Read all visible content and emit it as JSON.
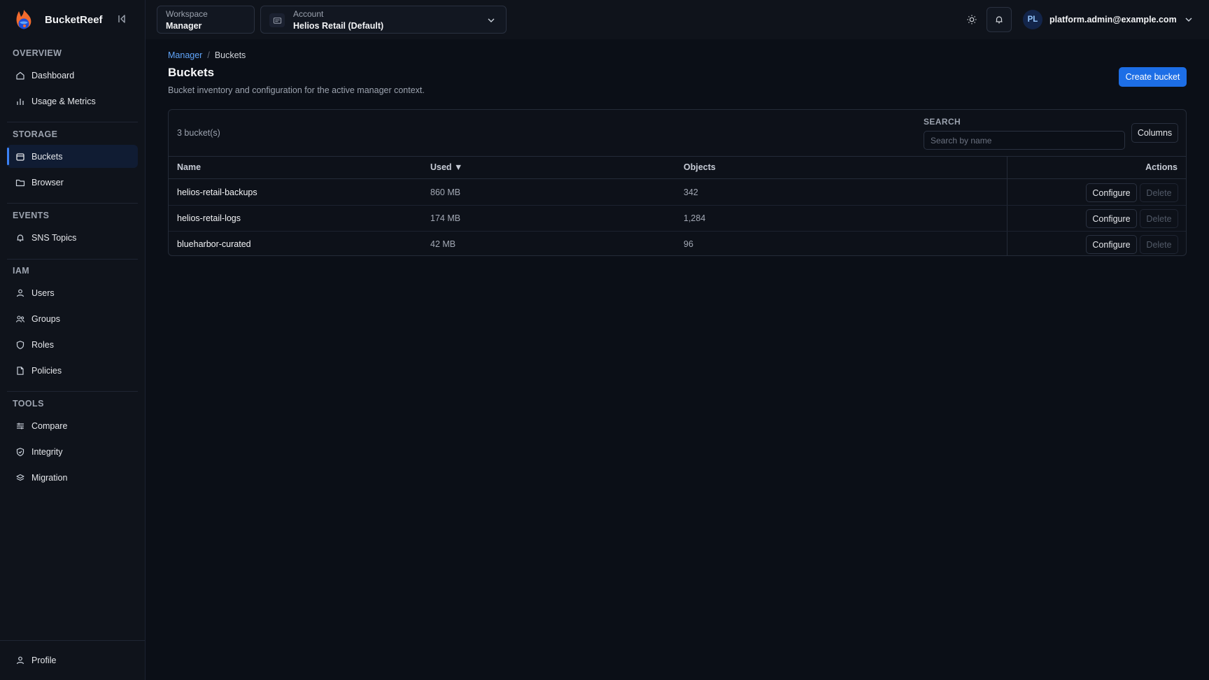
{
  "app": {
    "name": "BucketReef"
  },
  "sidebar": {
    "sections": [
      {
        "title": "OVERVIEW",
        "items": [
          {
            "label": "Dashboard",
            "icon": "home-icon"
          },
          {
            "label": "Usage & Metrics",
            "icon": "bar-chart-icon"
          }
        ]
      },
      {
        "title": "STORAGE",
        "items": [
          {
            "label": "Buckets",
            "icon": "bucket-icon",
            "active": true
          },
          {
            "label": "Browser",
            "icon": "folder-icon"
          }
        ]
      },
      {
        "title": "EVENTS",
        "items": [
          {
            "label": "SNS Topics",
            "icon": "bell-icon"
          }
        ]
      },
      {
        "title": "IAM",
        "items": [
          {
            "label": "Users",
            "icon": "user-icon"
          },
          {
            "label": "Groups",
            "icon": "users-icon"
          },
          {
            "label": "Roles",
            "icon": "shield-icon"
          },
          {
            "label": "Policies",
            "icon": "file-icon"
          }
        ]
      },
      {
        "title": "TOOLS",
        "items": [
          {
            "label": "Compare",
            "icon": "sliders-icon"
          },
          {
            "label": "Integrity",
            "icon": "shield-check-icon"
          },
          {
            "label": "Migration",
            "icon": "migration-icon"
          }
        ]
      }
    ],
    "footer": {
      "label": "Profile",
      "icon": "user-icon"
    }
  },
  "topbar": {
    "workspace": {
      "label": "Workspace",
      "value": "Manager"
    },
    "account": {
      "label": "Account",
      "value": "Helios Retail (Default)"
    },
    "user": {
      "initials": "PL",
      "email": "platform.admin@example.com"
    }
  },
  "breadcrumb": {
    "parent": "Manager",
    "separator": "/",
    "current": "Buckets"
  },
  "page": {
    "title": "Buckets",
    "description": "Bucket inventory and configuration for the active manager context.",
    "create_label": "Create bucket"
  },
  "table": {
    "count_text": "3 bucket(s)",
    "search_label": "SEARCH",
    "search_placeholder": "Search by name",
    "search_value": "",
    "columns_label": "Columns",
    "headers": {
      "name": "Name",
      "used": "Used ▼",
      "objects": "Objects",
      "actions": "Actions"
    },
    "configure_label": "Configure",
    "delete_label": "Delete",
    "rows": [
      {
        "name": "helios-retail-backups",
        "used": "860 MB",
        "objects": "342"
      },
      {
        "name": "helios-retail-logs",
        "used": "174 MB",
        "objects": "1,284"
      },
      {
        "name": "blueharbor-curated",
        "used": "42 MB",
        "objects": "96"
      }
    ]
  },
  "colors": {
    "accent": "#1d6ee6",
    "link": "#60a5fa",
    "background": "#0b0f17",
    "sidebar": "#0f131b"
  }
}
